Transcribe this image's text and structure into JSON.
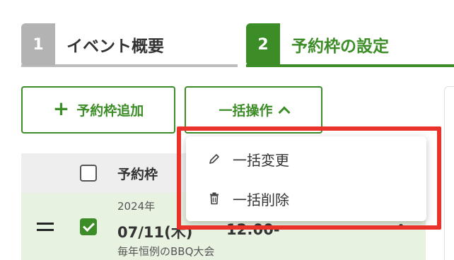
{
  "steps": [
    {
      "number": "1",
      "label": "イベント概要",
      "active": false
    },
    {
      "number": "2",
      "label": "予約枠の設定",
      "active": true
    }
  ],
  "toolbar": {
    "add_label": "予約枠追加",
    "bulk_label": "一括操作"
  },
  "table": {
    "column_title": "予約枠",
    "rows": [
      {
        "year": "2024年",
        "date": "07/11(木)",
        "time": "12:00-",
        "description": "毎年恒例のBBQ大会",
        "checked": true
      }
    ]
  },
  "dropdown": {
    "items": [
      {
        "label": "一括変更",
        "icon": "pencil-icon"
      },
      {
        "label": "一括削除",
        "icon": "trash-icon"
      }
    ]
  },
  "colors": {
    "accent": "#3c8c27",
    "inactive": "#b3b3b3",
    "highlight": "#e8322a",
    "row_selected": "#e8f2e1"
  }
}
